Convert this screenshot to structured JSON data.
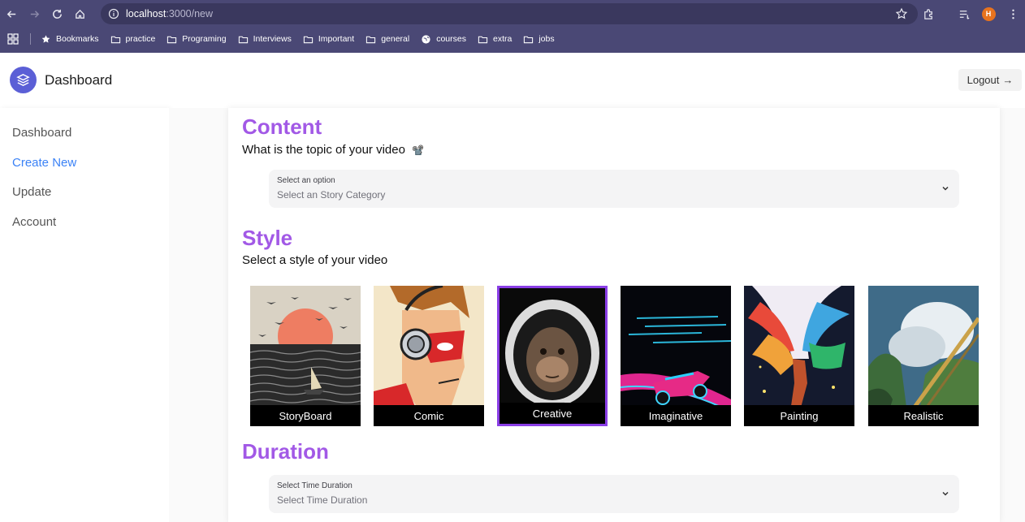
{
  "browser": {
    "url_host": "localhost",
    "url_path": ":3000/new",
    "profile_initial": "H",
    "bookmarks": [
      {
        "label": "Bookmarks",
        "icon": "star-icon"
      },
      {
        "label": "practice",
        "icon": "folder-icon"
      },
      {
        "label": "Programing",
        "icon": "folder-icon"
      },
      {
        "label": "Interviews",
        "icon": "folder-icon"
      },
      {
        "label": "Important",
        "icon": "folder-icon"
      },
      {
        "label": "general",
        "icon": "folder-icon"
      },
      {
        "label": "courses",
        "icon": "globe-icon"
      },
      {
        "label": "extra",
        "icon": "folder-icon"
      },
      {
        "label": "jobs",
        "icon": "folder-icon"
      }
    ]
  },
  "header": {
    "title": "Dashboard",
    "logout_label": "Logout",
    "logout_arrow": "→"
  },
  "sidebar": {
    "items": [
      {
        "label": "Dashboard",
        "active": false
      },
      {
        "label": "Create New",
        "active": true
      },
      {
        "label": "Update",
        "active": false
      },
      {
        "label": "Account",
        "active": false
      }
    ]
  },
  "content": {
    "title": "Content",
    "subtitle": "What is the topic of your video",
    "subtitle_emoji": "📽️",
    "select_label": "Select an option",
    "select_value": "Select an Story Category"
  },
  "style": {
    "title": "Style",
    "subtitle": "Select a style of your video",
    "options": [
      {
        "label": "StoryBoard",
        "selected": false
      },
      {
        "label": "Comic",
        "selected": false
      },
      {
        "label": "Creative",
        "selected": true
      },
      {
        "label": "Imaginative",
        "selected": false
      },
      {
        "label": "Painting",
        "selected": false
      },
      {
        "label": "Realistic",
        "selected": false
      }
    ]
  },
  "duration": {
    "title": "Duration",
    "select_label": "Select Time Duration",
    "select_value": "Select Time Duration"
  },
  "colors": {
    "accent": "#a259e6",
    "active_link": "#3b82f6",
    "chrome": "#4a4875",
    "selected_border": "#8a3ee6"
  }
}
